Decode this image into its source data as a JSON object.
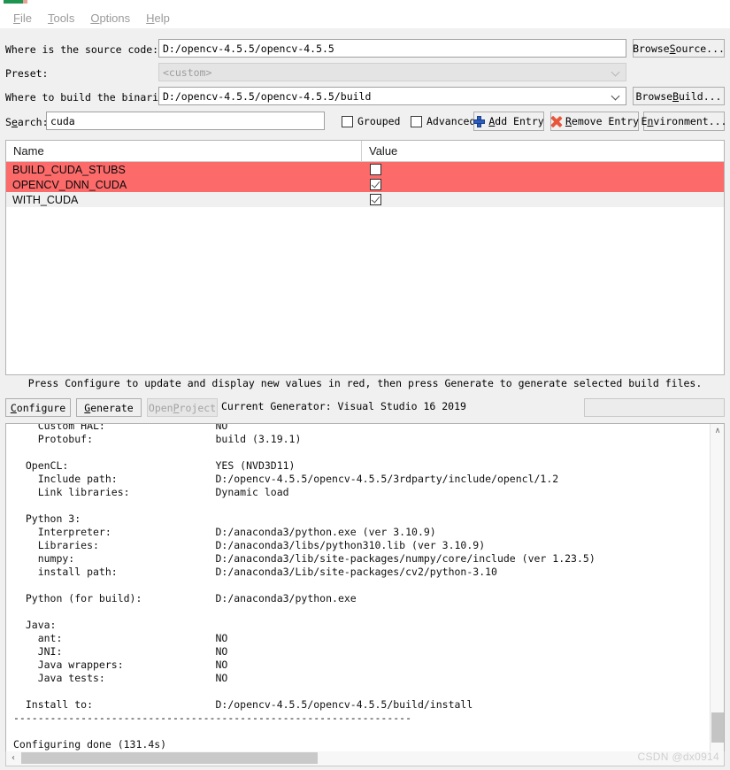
{
  "menubar": {
    "items": [
      {
        "mnemonic": "F",
        "rest": "ile"
      },
      {
        "mnemonic": "T",
        "rest": "ools"
      },
      {
        "mnemonic": "O",
        "rest": "ptions"
      },
      {
        "mnemonic": "H",
        "rest": "elp"
      }
    ]
  },
  "form": {
    "source_label": "Where is the source code:",
    "source_value": "D:/opencv-4.5.5/opencv-4.5.5",
    "browse_source_mnemonic": "S",
    "browse_source_pre": "Browse ",
    "browse_source_post": "ource...",
    "preset_label": "Preset:",
    "preset_value": "<custom>",
    "build_label": "Where to build the binaries:",
    "build_value": "D:/opencv-4.5.5/opencv-4.5.5/build",
    "browse_build_mnemonic": "B",
    "browse_build_pre": "Browse ",
    "browse_build_post": "uild..."
  },
  "toolbar": {
    "search_label_pre": "S",
    "search_label_mnemonic": "e",
    "search_label_post": "arch:",
    "search_value": "cuda",
    "grouped_label": "Grouped",
    "grouped_checked": false,
    "advanced_label": "Advanced",
    "advanced_checked": false,
    "add_entry_pre": "",
    "add_entry_mnemonic": "A",
    "add_entry_post": "dd Entry",
    "remove_entry_pre": "",
    "remove_entry_mnemonic": "R",
    "remove_entry_post": "emove Entry",
    "environment_pre": "E",
    "environment_mnemonic": "n",
    "environment_post": "vironment..."
  },
  "table": {
    "columns": [
      "Name",
      "Value"
    ],
    "rows": [
      {
        "name": "BUILD_CUDA_STUBS",
        "checked": false,
        "highlight": true
      },
      {
        "name": "OPENCV_DNN_CUDA",
        "checked": true,
        "highlight": true
      },
      {
        "name": "WITH_CUDA",
        "checked": true,
        "highlight": false
      }
    ],
    "new_value_color": "#fc6a6a"
  },
  "status": {
    "hint": "Press Configure to update and display new values in red, then press Generate to generate selected build files.",
    "generator_text": "Current Generator: Visual Studio 16 2019"
  },
  "actions": {
    "configure_mnemonic": "C",
    "configure_pre": "",
    "configure_post": "onfigure",
    "generate_mnemonic": "G",
    "generate_pre": "",
    "generate_post": "enerate",
    "open_project_pre": "Open ",
    "open_project_mnemonic": "P",
    "open_project_post": "roject",
    "open_project_enabled": false
  },
  "log": {
    "content": "    Custom HAL:                  NO\n    Protobuf:                    build (3.19.1)\n\n  OpenCL:                        YES (NVD3D11)\n    Include path:                D:/opencv-4.5.5/opencv-4.5.5/3rdparty/include/opencl/1.2\n    Link libraries:              Dynamic load\n\n  Python 3:\n    Interpreter:                 D:/anaconda3/python.exe (ver 3.10.9)\n    Libraries:                   D:/anaconda3/libs/python310.lib (ver 3.10.9)\n    numpy:                       D:/anaconda3/lib/site-packages/numpy/core/include (ver 1.23.5)\n    install path:                D:/anaconda3/Lib/site-packages/cv2/python-3.10\n\n  Python (for build):            D:/anaconda3/python.exe\n\n  Java:\n    ant:                         NO\n    JNI:                         NO\n    Java wrappers:               NO\n    Java tests:                  NO\n\n  Install to:                    D:/opencv-4.5.5/opencv-4.5.5/build/install\n-----------------------------------------------------------------\n\nConfiguring done (131.4s)"
  },
  "scrollbars": {
    "up_arrow": "∧",
    "down_arrow": "∨",
    "left_arrow": "‹"
  },
  "watermark": "CSDN @dx0914"
}
